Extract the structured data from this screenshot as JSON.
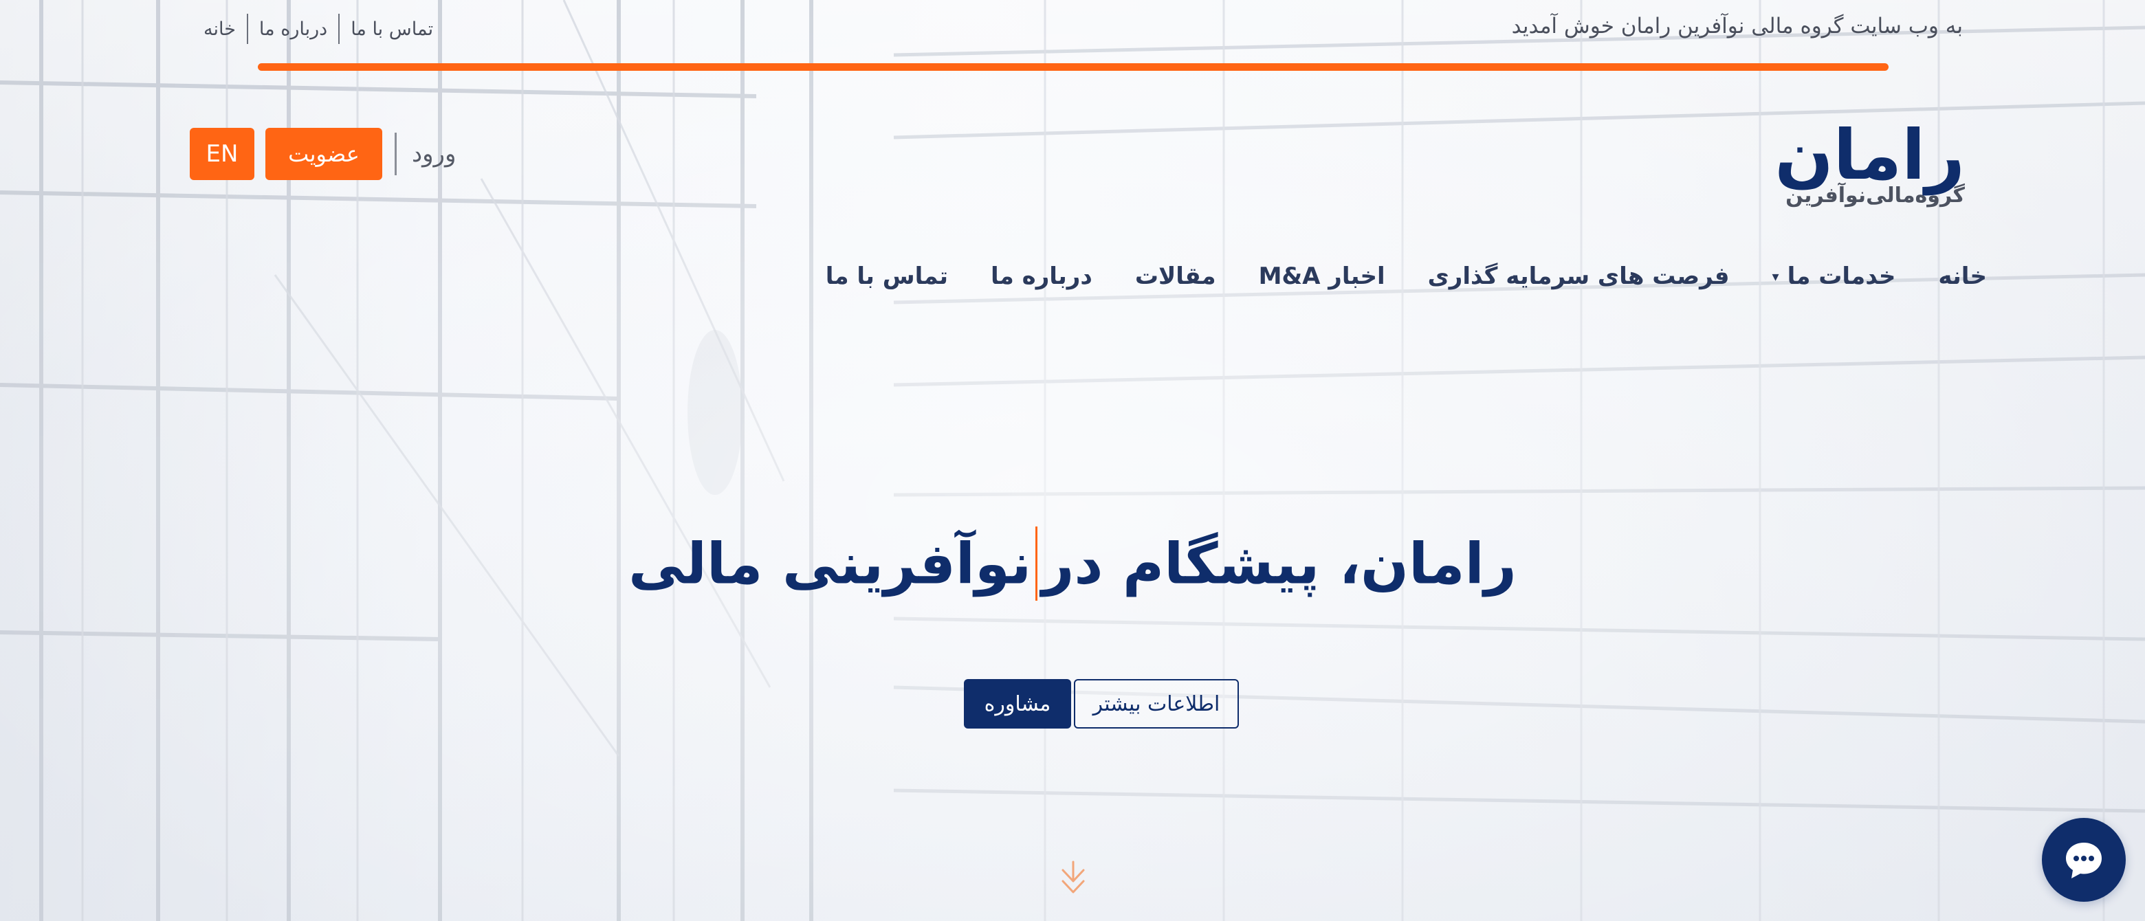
{
  "topbar": {
    "welcome_text": "به وب سایت گروه مالی نوآفرین رامان خوش آمدید",
    "links": [
      "خانه",
      "درباره ما",
      "تماس با ما"
    ]
  },
  "logo": {
    "wordmark": "رامان",
    "subtitle": "گروه‌مالی‌نوآفرین"
  },
  "header_actions": {
    "language_label": "EN",
    "join_label": "عضویت",
    "login_label": "ورود"
  },
  "nav": {
    "items": [
      {
        "label": "خانه",
        "has_dropdown": false
      },
      {
        "label": "خدمات ما",
        "has_dropdown": true
      },
      {
        "label": "فرصت های سرمایه گذاری",
        "has_dropdown": false
      },
      {
        "label": "اخبار M&A",
        "has_dropdown": false
      },
      {
        "label": "مقالات",
        "has_dropdown": false
      },
      {
        "label": "درباره ما",
        "has_dropdown": false
      },
      {
        "label": "تماس با ما",
        "has_dropdown": false
      }
    ],
    "dropdown_glyph": "▾"
  },
  "hero": {
    "title_part1": "رامان، پیشگام در",
    "title_part2": "نوآفرینی مالی",
    "consult_label": "مشاوره",
    "more_info_label": "اطلاعات بیشتر"
  },
  "icons": {
    "scroll": "scroll-down-arrow-icon",
    "chat": "chat-bubble-icon"
  },
  "colors": {
    "accent_orange": "#ff6514",
    "brand_navy": "#0f2d6b",
    "nav_text": "#2b3a5c",
    "muted_text": "#4a4f5c"
  }
}
